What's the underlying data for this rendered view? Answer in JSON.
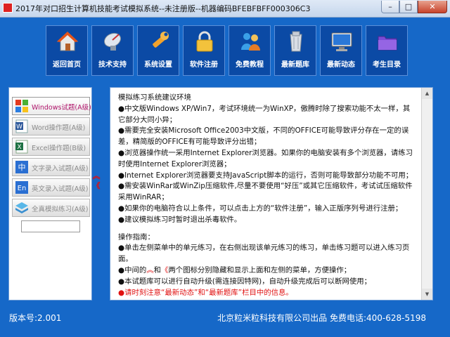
{
  "window": {
    "title": "2017年对口招生计算机技能考试模拟系统--未注册版--机器编码BFEBFBFF000306C3",
    "minimize": "–",
    "maximize": "□",
    "close": "✕"
  },
  "toolbar": {
    "items": [
      {
        "label": "返回首页",
        "icon": "home-icon"
      },
      {
        "label": "技术支持",
        "icon": "satellite-dish-icon"
      },
      {
        "label": "系统设置",
        "icon": "wrench-icon"
      },
      {
        "label": "软件注册",
        "icon": "padlock-icon"
      },
      {
        "label": "免费教程",
        "icon": "people-icon"
      },
      {
        "label": "最新题库",
        "icon": "recycle-bin-icon"
      },
      {
        "label": "最新动态",
        "icon": "monitor-icon"
      },
      {
        "label": "考生目录",
        "icon": "purple-folder-icon"
      }
    ]
  },
  "sidebar": {
    "items": [
      {
        "label": "Windows试题(A级)",
        "icon": "windows-logo-icon",
        "active": true
      },
      {
        "label": "Word操作题(A级)",
        "icon": "word-document-icon",
        "active": false
      },
      {
        "label": "Excel操作题(B级)",
        "icon": "excel-sheet-icon",
        "active": false
      },
      {
        "label": "文字录入试题(A级)",
        "icon": "chinese-input-icon",
        "active": false
      },
      {
        "label": "英文录入试题(A级)",
        "icon": "english-input-icon",
        "active": false
      },
      {
        "label": "全真模拟练习(A级)",
        "icon": "stack-layers-icon",
        "active": false
      }
    ],
    "input_value": ""
  },
  "content": {
    "heading": "模拟练习系统建议环境",
    "env_items": [
      "●中文版Windows XP/Win7，考试环境统一为WinXP，傲腾时除了搜索功能不太一样，其它部分大同小异；",
      "●需要完全安装Microsoft Office2003中文版，不同的OFFICE可能导致评分存在一定的误差，精简版的OFFICE有可能导致评分出错；",
      "●浏览器操作统一采用Internet Explorer浏览器。如果你的电脑安装有多个浏览器，请练习时使用Internet Explorer浏览器；",
      "●Internet Explorer浏览器要支持JavaScript脚本的运行，否则可能导致部分功能不可用；",
      "●需安装WinRar或WinZip压缩软件,尽量不要使用“好压”或其它压缩软件，考试试压缩软件采用WinRAR；",
      "●如果你的电脑符合以上条件，可以点击上方的“软件注册”，输入正版序列号进行注册；",
      "●建议模拟练习时暂时退出杀毒软件。"
    ],
    "guide_heading": "操作指南：",
    "guide_items": [
      "●单击左侧菜单中的单元练习，在右侧出现该单元练习的练习，单击练习题可以进入练习页面。",
      "●本试题库可以进行自动升级(需连接因特网)，自动升级完成后可以断网使用；"
    ],
    "guide_arrows_pre": "●中间的",
    "guide_arrows_up": "︽",
    "guide_arrows_mid": "和",
    "guide_arrows_left": "《",
    "guide_arrows_post": "两个图标分别隐藏和显示上面和左侧的菜单，方便操作；",
    "guide_notice": "●请时刻注意“最新动态”和“最新题库”栏目中的信息。",
    "scroll_up": "▲",
    "scroll_down": "▼"
  },
  "collapse_arrows": {
    "up": "︽",
    "left": "《"
  },
  "status": {
    "version": "版本号:2.001",
    "company": "北京粒米粒科技有限公司出品  免费电话:400-628-5198"
  }
}
